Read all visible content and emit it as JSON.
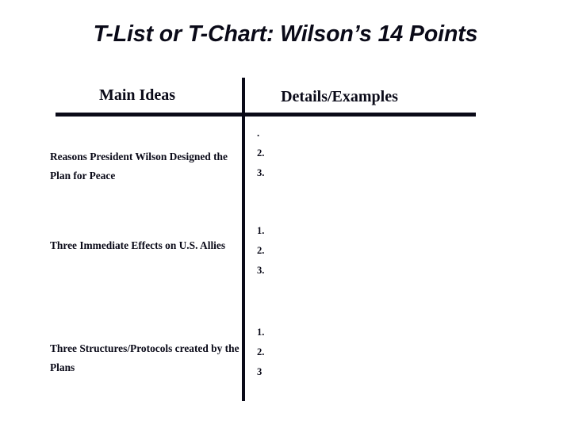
{
  "slide": {
    "title": "T-List or T-Chart: Wilson’s 14 Points",
    "headers": {
      "left": "Main Ideas",
      "right": "Details/Examples"
    },
    "rows": [
      {
        "main_idea": "Reasons President Wilson Designed the Plan for Peace",
        "details": [
          ".",
          "2.",
          "3."
        ]
      },
      {
        "main_idea": "Three Immediate Effects on U.S. Allies",
        "details": [
          "1.",
          "2.",
          "3."
        ]
      },
      {
        "main_idea": "Three Structures/Protocols created by the Plans",
        "details": [
          "1.",
          "2.",
          "3"
        ]
      }
    ]
  },
  "colors": {
    "ink": "#0a0a18",
    "background": "#ffffff"
  }
}
